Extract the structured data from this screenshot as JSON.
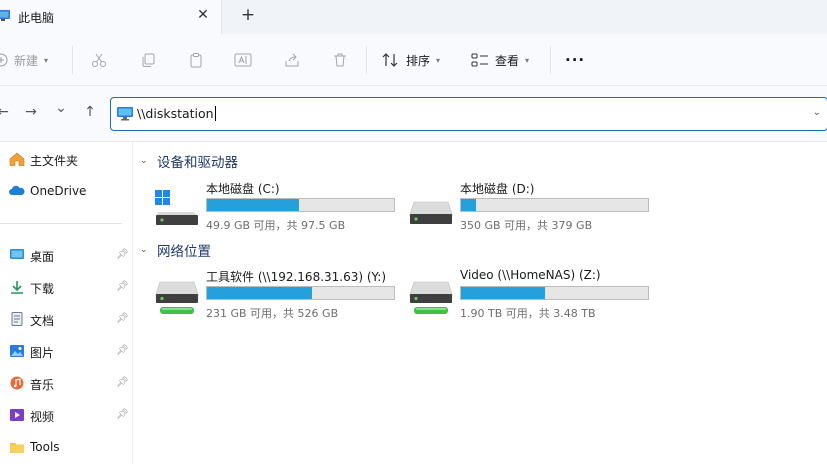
{
  "tab": {
    "title": "此电脑",
    "close": "✕",
    "new_tab": "+"
  },
  "toolbar": {
    "new_label": "新建",
    "sort_label": "排序",
    "view_label": "查看",
    "more_label": "···"
  },
  "nav": {
    "back": "←",
    "forward": "→",
    "recent": "⌄",
    "up": "↑"
  },
  "address": {
    "value": "\\\\diskstation",
    "dropdown": "⌄"
  },
  "sidebar": {
    "top": [
      {
        "label": "主文件夹",
        "icon": "home-icon"
      },
      {
        "label": "OneDrive",
        "icon": "cloud-icon"
      }
    ],
    "pinned": [
      {
        "label": "桌面",
        "icon": "desktop-icon"
      },
      {
        "label": "下载",
        "icon": "download-icon"
      },
      {
        "label": "文档",
        "icon": "document-icon"
      },
      {
        "label": "图片",
        "icon": "pictures-icon"
      },
      {
        "label": "音乐",
        "icon": "music-icon"
      },
      {
        "label": "视频",
        "icon": "video-icon"
      }
    ],
    "other": [
      {
        "label": "Tools",
        "icon": "folder-icon"
      }
    ]
  },
  "groups": {
    "devices": {
      "title": "设备和驱动器",
      "drives": [
        {
          "name": "本地磁盘 (C:)",
          "free": "49.9 GB 可用，共 97.5 GB",
          "usage": 0.49,
          "icon": "system-drive-icon"
        },
        {
          "name": "本地磁盘 (D:)",
          "free": "350 GB 可用，共 379 GB",
          "usage": 0.08,
          "icon": "hard-drive-icon"
        }
      ]
    },
    "network": {
      "title": "网络位置",
      "drives": [
        {
          "name": "工具软件 (\\\\192.168.31.63) (Y:)",
          "free": "231 GB 可用，共 526 GB",
          "usage": 0.56,
          "icon": "network-drive-icon"
        },
        {
          "name": "Video (\\\\HomeNAS) (Z:)",
          "free": "1.90 TB 可用，共 3.48 TB",
          "usage": 0.45,
          "icon": "network-drive-icon"
        }
      ]
    }
  },
  "colors": {
    "accent": "#26a0da",
    "focus_border": "#1a6fb0",
    "group_title": "#1f3a6a"
  }
}
